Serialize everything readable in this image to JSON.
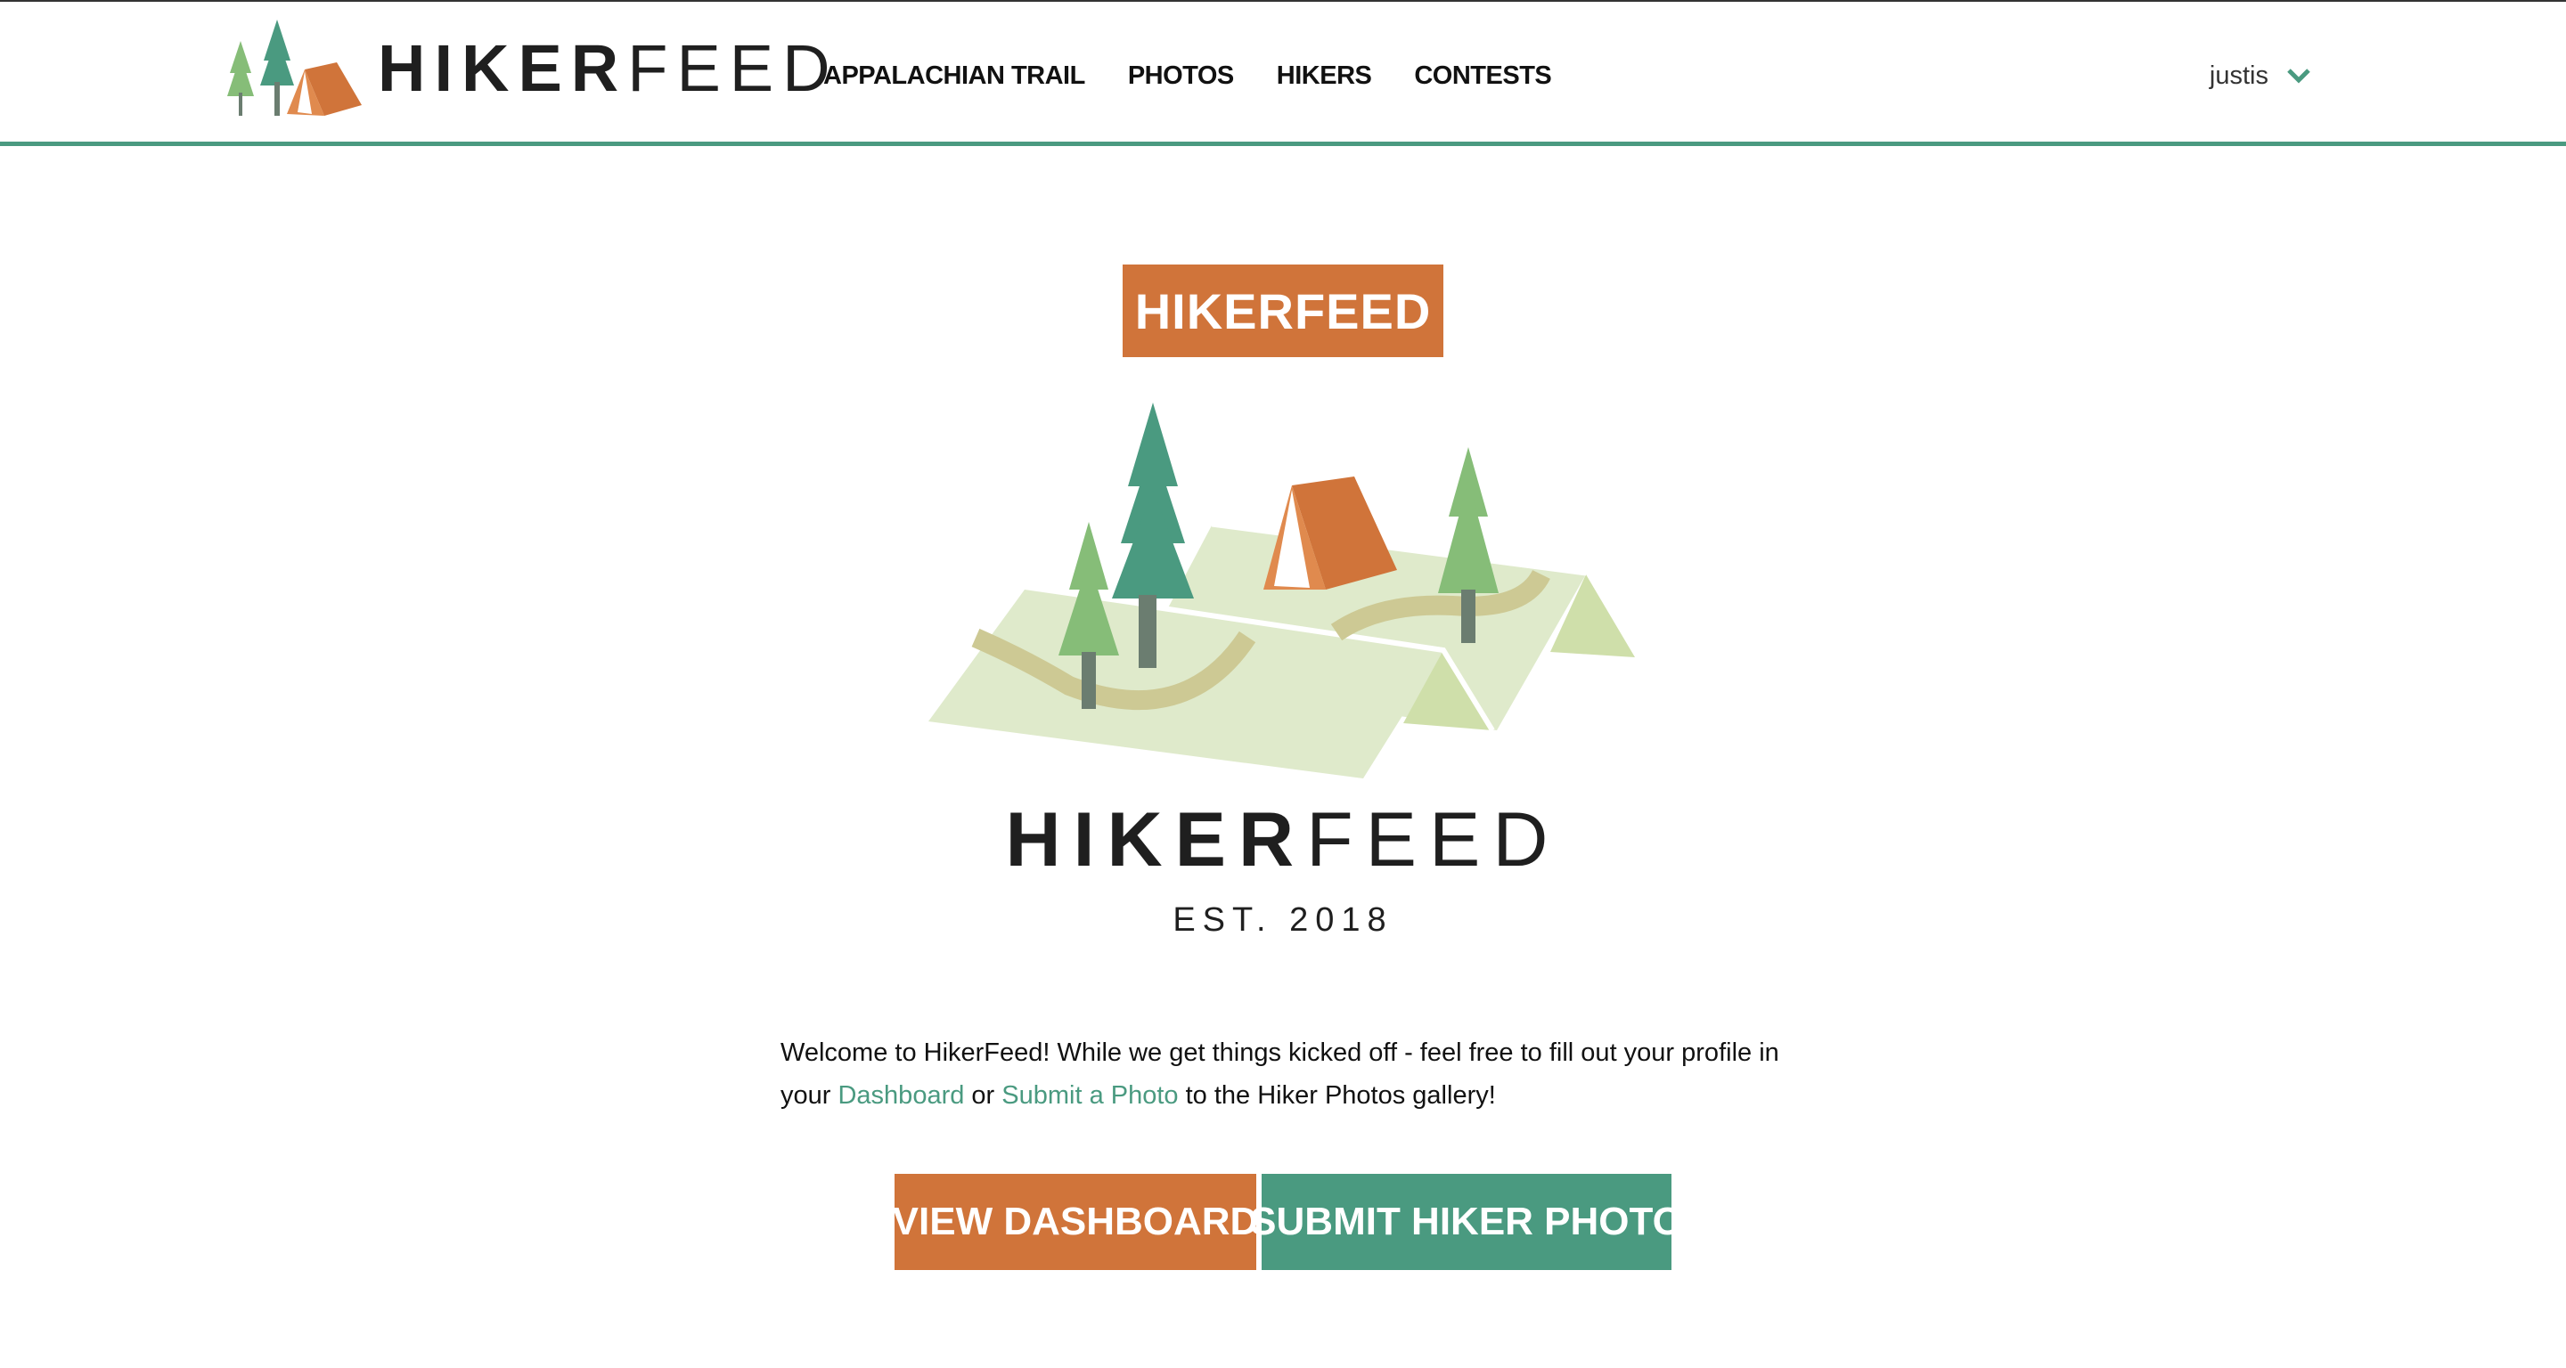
{
  "header": {
    "logo_bold": "HIKER",
    "logo_thin": "FEED",
    "nav": [
      {
        "label": "APPALACHIAN TRAIL"
      },
      {
        "label": "PHOTOS"
      },
      {
        "label": "HIKERS"
      },
      {
        "label": "CONTESTS"
      }
    ],
    "user": {
      "name": "justis",
      "icon": "chevron-down-icon"
    }
  },
  "hero": {
    "badge": "HIKERFEED",
    "title_bold": "HIKER",
    "title_thin": "FEED",
    "est": "EST. 2018",
    "illustration": "campsite-map-illustration"
  },
  "welcome": {
    "text_1": "Welcome to HikerFeed! While we get things kicked off - feel free to fill out your profile in your ",
    "link_dashboard": "Dashboard",
    "text_2": " or ",
    "link_submit": "Submit a Photo",
    "text_3": " to the Hiker Photos gallery!"
  },
  "buttons": {
    "view_dashboard": "VIEW DASHBOARD",
    "submit_photo": "SUBMIT HIKER PHOTO"
  },
  "colors": {
    "accent_green": "#4a9a80",
    "accent_orange": "#d0743a",
    "tree_light": "#86bd78",
    "map_light": "#dfeacb",
    "path": "#cdc994"
  }
}
